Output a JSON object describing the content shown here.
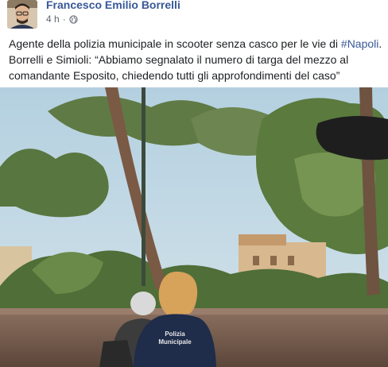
{
  "post": {
    "author": "Francesco Emilio Borrelli",
    "time": "4 h",
    "separator": "·",
    "privacy_icon": "globe-icon",
    "text_line1_prefix": "Agente della polizia municipale in scooter senza casco per le vie di ",
    "hashtag": "#Napoli",
    "text_line1_suffix": ".",
    "text_rest": "Borrelli e Simioli: “Abbiamo segnalato il numero di targa del mezzo al comandante Esposito, chiedendo tutti gli approfondimenti del caso”"
  },
  "photo": {
    "vest_text_1": "Polizia",
    "vest_text_2": "Municipale"
  },
  "colors": {
    "link": "#385898",
    "text": "#1c1e21",
    "meta": "#616770",
    "sky": "#b9d3e2"
  }
}
